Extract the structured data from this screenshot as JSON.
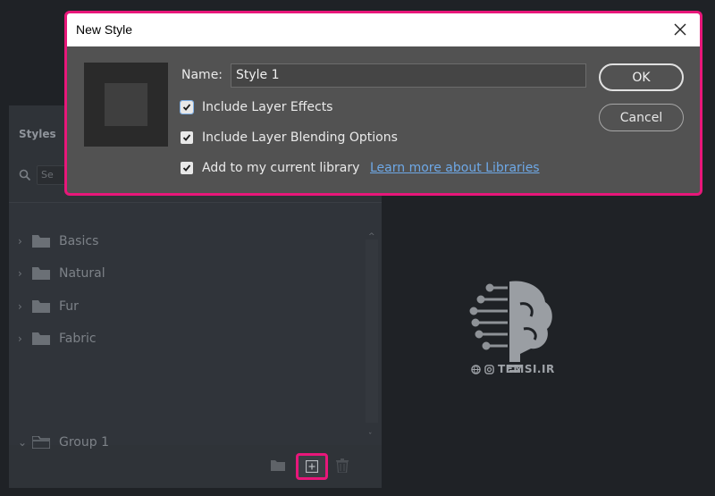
{
  "dialog": {
    "title": "New Style",
    "name_label": "Name:",
    "name_value": "Style 1",
    "options": [
      {
        "label": "Include Layer Effects",
        "checked": true
      },
      {
        "label": "Include Layer Blending Options",
        "checked": true
      },
      {
        "label": "Add to my current library",
        "checked": true
      }
    ],
    "learn_more_link": "Learn more about Libraries",
    "ok_label": "OK",
    "cancel_label": "Cancel",
    "close_icon": "close-icon",
    "highlight_color": "#e8177a"
  },
  "styles_panel": {
    "title": "Styles",
    "search_placeholder": "Se",
    "folders": [
      {
        "label": "Basics",
        "expanded": false
      },
      {
        "label": "Natural",
        "expanded": false
      },
      {
        "label": "Fur",
        "expanded": false
      },
      {
        "label": "Fabric",
        "expanded": false
      }
    ],
    "group": {
      "label": "Group 1",
      "expanded": true
    },
    "footer_icons": [
      "folder-icon",
      "new-style-icon",
      "trash-icon"
    ]
  },
  "watermark": {
    "text": "TEMSI.IR"
  }
}
